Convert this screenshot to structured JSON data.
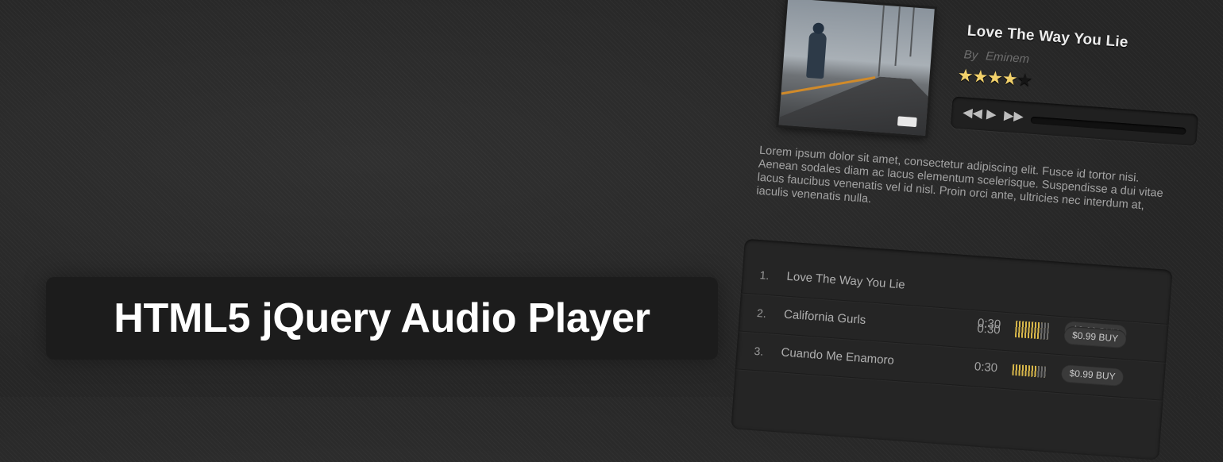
{
  "banner": {
    "title": "HTML5 jQuery Audio Player"
  },
  "player": {
    "song_title": "Love The Way You Lie",
    "artist_prefix": "By",
    "artist": "Eminem",
    "rating": 4,
    "rating_max": 5,
    "controls": {
      "rewind_icon": "rewind-icon",
      "play_icon": "play-icon",
      "forward_icon": "fast-forward-icon"
    },
    "progress": 0
  },
  "description": "Lorem ipsum dolor sit amet, consectetur adipiscing elit. Fusce id tortor nisi. Aenean sodales diam ac lacus elementum scelerisque. Suspendisse a dui vitae lacus faucibus venenatis vel id nisl. Proin orci ante, ultricies nec interdum at, iaculis venenatis nulla.",
  "playlist": [
    {
      "num": "1.",
      "name": "Love The Way You Lie",
      "duration": "0:30",
      "buy": ""
    },
    {
      "num": "2.",
      "name": "California Gurls",
      "duration": "0:30",
      "buy": "$0.99 BUY"
    },
    {
      "num": "3.",
      "name": "Cuando Me Enamoro",
      "duration": "0:30",
      "buy": "$0.99 BUY"
    }
  ],
  "colors": {
    "accent": "#f2d16b",
    "background": "#2a2a2a",
    "banner": "#1c1c1c"
  }
}
